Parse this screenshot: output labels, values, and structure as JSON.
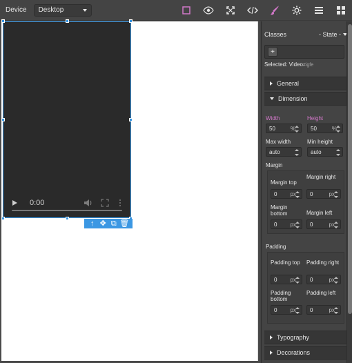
{
  "topbar": {
    "device_label": "Device",
    "device_value": "Desktop",
    "icons": {
      "box": "square-outline-icon",
      "preview": "eye-icon",
      "fullscreen": "fullscreen-icon",
      "code": "code-icon",
      "style": "brush-icon",
      "settings": "gear-icon",
      "layers": "menu-icon",
      "blocks": "grid-icon"
    }
  },
  "canvas": {
    "video": {
      "time": "0:00",
      "icons": {
        "play": "play-icon",
        "volume": "volume-icon",
        "fullscreen": "fullscreen-icon",
        "more": "more-vertical-icon"
      }
    },
    "toolbar_icons": {
      "up": "arrow-up-icon",
      "move": "move-icon",
      "copy": "copy-icon",
      "delete": "trash-icon"
    }
  },
  "panel": {
    "classes_label": "Classes",
    "state_label": "- State -",
    "add_label": "+",
    "selected_label": "Selected:",
    "selected_value": "Video",
    "selected_id": "#igfe",
    "sectors": {
      "general": "General",
      "dimension": "Dimension",
      "typography": "Typography",
      "decorations": "Decorations"
    },
    "dimension": {
      "width_label": "Width",
      "height_label": "Height",
      "width_value": "50",
      "width_unit": "%",
      "height_value": "50",
      "height_unit": "%",
      "max_width_label": "Max width",
      "min_height_label": "Min height",
      "max_width_value": "auto",
      "min_height_value": "auto",
      "margin_title": "Margin",
      "padding_title": "Padding",
      "margin_top_label": "Margin top",
      "margin_right_label": "Margin right",
      "margin_bottom_label": "Margin bottom",
      "margin_left_label": "Margin left",
      "padding_top_label": "Padding top",
      "padding_right_label": "Padding right",
      "padding_bottom_label": "Padding bottom",
      "padding_left_label": "Padding left",
      "zero": "0",
      "px": "px"
    }
  },
  "colors": {
    "accent": "#d278c9",
    "selection_blue": "#3b97e3"
  }
}
